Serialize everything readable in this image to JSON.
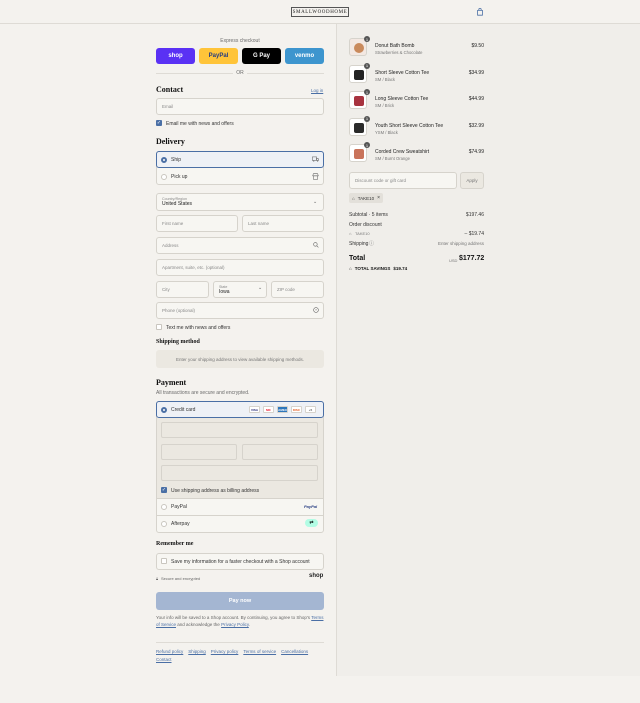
{
  "header": {
    "logo": "SMALLWOODHOME",
    "cart_icon": "shopping-bag-icon"
  },
  "express": {
    "label": "Express checkout",
    "buttons": [
      {
        "label": "shop",
        "bg": "#5a31f4",
        "fg": "#ffffff"
      },
      {
        "label": "PayPal",
        "bg": "#ffc439",
        "fg": "#253b80"
      },
      {
        "label": "G Pay",
        "bg": "#000000",
        "fg": "#ffffff"
      },
      {
        "label": "venmo",
        "bg": "#3d95ce",
        "fg": "#ffffff"
      }
    ],
    "or": "OR"
  },
  "contact": {
    "title": "Contact",
    "login": "Log in",
    "email_placeholder": "Email",
    "newsletter": "Email me with news and offers",
    "newsletter_checked": true
  },
  "delivery": {
    "title": "Delivery",
    "options": [
      {
        "label": "Ship",
        "selected": true,
        "icon": "truck-icon"
      },
      {
        "label": "Pick up",
        "selected": false,
        "icon": "store-icon"
      }
    ],
    "country_label": "Country/Region",
    "country_value": "United States",
    "first_name": "First name",
    "last_name": "Last name",
    "address": "Address",
    "apartment": "Apartment, suite, etc. (optional)",
    "city": "City",
    "state_label": "State",
    "state_value": "Iowa",
    "zip": "ZIP code",
    "phone": "Phone (optional)",
    "text_me": "Text me with news and offers"
  },
  "shipping_method": {
    "title": "Shipping method",
    "notice": "Enter your shipping address to view available shipping methods."
  },
  "payment": {
    "title": "Payment",
    "subtitle": "All transactions are secure and encrypted.",
    "credit_card": "Credit card",
    "cards": [
      {
        "label": "VISA",
        "bg": "#ffffff",
        "fg": "#1a1f71"
      },
      {
        "label": "MC",
        "bg": "#ffffff",
        "fg": "#eb001b"
      },
      {
        "label": "AMEX",
        "bg": "#2e77bc",
        "fg": "#ffffff"
      },
      {
        "label": "DISC",
        "bg": "#ffffff",
        "fg": "#e55c20"
      },
      {
        "label": "+5",
        "bg": "#ffffff",
        "fg": "#555555"
      }
    ],
    "billing_same": "Use shipping address as billing address",
    "paypal": "PayPal",
    "paypal_logo": "PayPal",
    "afterpay": "Afterpay"
  },
  "remember": {
    "title": "Remember me",
    "save_info": "Save my information for a faster checkout with a Shop account",
    "secure": "Secure and encrypted",
    "shop": "shop"
  },
  "pay_now": "Pay now",
  "legal": {
    "text1": "Your info will be saved to a Shop account. By continuing, you agree to Shop's",
    "tos": "Terms of Service",
    "text2": "and acknowledge the",
    "privacy": "Privacy Policy",
    "end": "."
  },
  "footer_links": [
    "Refund policy",
    "Shipping",
    "Privacy policy",
    "Terms of service",
    "Cancellations",
    "Contact"
  ],
  "order": {
    "items": [
      {
        "name": "Donut Bath Bomb",
        "variant": "Strawberries & Chocolate",
        "price": "$9.50",
        "qty": "1",
        "color": "#f3e8e2",
        "swatch": "#c98a5c"
      },
      {
        "name": "Short Sleeve Cotton Tee",
        "variant": "SM / Black",
        "price": "$34.99",
        "qty": "1",
        "color": "#ffffff",
        "swatch": "#222222"
      },
      {
        "name": "Long Sleeve Cotton Tee",
        "variant": "SM / Brick",
        "price": "$44.99",
        "qty": "1",
        "color": "#ffffff",
        "swatch": "#a8333f"
      },
      {
        "name": "Youth Short Sleeve Cotton Tee",
        "variant": "YSM / Black",
        "price": "$32.99",
        "qty": "1",
        "color": "#ffffff",
        "swatch": "#2a2a2a"
      },
      {
        "name": "Corded Crew Sweatshirt",
        "variant": "SM / Burnt Orange",
        "price": "$74.99",
        "qty": "1",
        "color": "#ffffff",
        "swatch": "#c9735a"
      }
    ],
    "discount_placeholder": "Discount code or gift card",
    "apply": "Apply",
    "code": "TAKE10",
    "subtotal_label": "Subtotal · 5 items",
    "subtotal": "$197.46",
    "order_discount": "Order discount",
    "discount_code": "TAKE10",
    "discount_value": "– $19.74",
    "shipping_label": "Shipping",
    "shipping_value": "Enter shipping address",
    "total_label": "Total",
    "currency": "USD",
    "total": "$177.72",
    "savings_label": "TOTAL SAVINGS",
    "savings": "$19.74"
  }
}
